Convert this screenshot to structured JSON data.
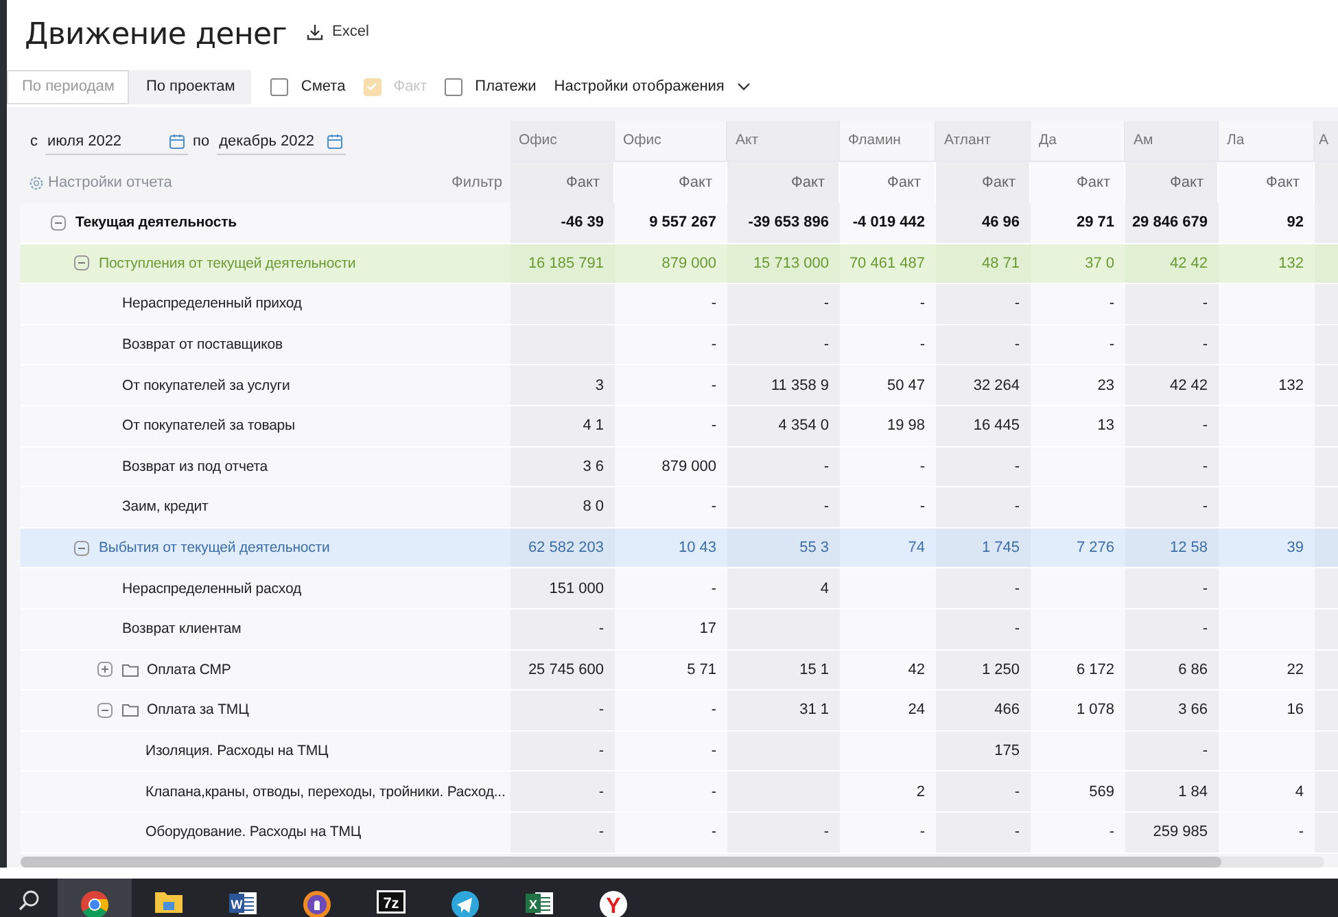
{
  "page": {
    "title": "Движение денег",
    "export_label": "Excel"
  },
  "view_tabs": [
    {
      "label": "По периодам",
      "selected": false
    },
    {
      "label": "По проектам",
      "selected": true
    }
  ],
  "toggles": [
    {
      "label": "Смета",
      "checked": false,
      "disabled": false
    },
    {
      "label": "Факт",
      "checked": true,
      "disabled": true
    },
    {
      "label": "Платежи",
      "checked": false,
      "disabled": false
    }
  ],
  "display_settings": "Настройки отображения",
  "period": {
    "from_prefix": "с",
    "from": "июля 2022",
    "to_prefix": "по",
    "to": "декабрь 2022"
  },
  "report_settings": "Настройки отчета",
  "filter": "Фильтр",
  "table": {
    "columns": [
      {
        "project": "Офис",
        "measure": "Факт"
      },
      {
        "project": "Офис",
        "measure": "Факт"
      },
      {
        "project": "Акт",
        "measure": "Факт"
      },
      {
        "project": "Фламин",
        "measure": "Факт"
      },
      {
        "project": "Атлант",
        "measure": "Факт"
      },
      {
        "project": "Да",
        "measure": "Факт"
      },
      {
        "project": "Ам",
        "measure": "Факт"
      },
      {
        "project": "Ла",
        "measure": "Факт"
      },
      {
        "project": "А"
      }
    ],
    "rows": [
      {
        "label": "Текущая деятельность",
        "kind": "total",
        "expanded": true,
        "values": {
          "column_1": "-46 39",
          "column_2": "9 557 267",
          "column_3": "-39 653 896",
          "column_4": "-4 019 442",
          "column_5": "46 96",
          "column_6": "29 71",
          "column_7": "29 846 679",
          "column_8": "92"
        },
        "children": [
          {
            "label": "Поступления от текущей деятельности",
            "kind": "income",
            "expanded": true,
            "values": {
              "column_1": "16 185 791",
              "column_2": "879 000",
              "column_3": "15 713 000",
              "column_4": "70 461 487",
              "column_5": "48 71",
              "column_6": "37 0",
              "column_7": "42 42",
              "column_8": "132"
            },
            "children": [
              {
                "label": "Нераспределенный приход",
                "kind": "item",
                "values": {
                  "column_2": "-",
                  "column_3": "-",
                  "column_4": "-",
                  "column_5": "-",
                  "column_6": "-",
                  "column_7": "-"
                }
              },
              {
                "label": "Возврат от поставщиков",
                "kind": "item",
                "values": {
                  "column_2": "-",
                  "column_3": "-",
                  "column_4": "-",
                  "column_5": "-",
                  "column_6": "-",
                  "column_7": "-"
                }
              },
              {
                "label": "От покупателей за услуги",
                "kind": "item",
                "values": {
                  "column_1": "3",
                  "column_2": "-",
                  "column_3": "11 358 9",
                  "column_4": "50 47",
                  "column_5": "32 264",
                  "column_6": "23",
                  "column_7": "42 42",
                  "column_8": "132"
                }
              },
              {
                "label": "От покупателей за товары",
                "kind": "item",
                "values": {
                  "column_1": "4 1",
                  "column_2": "-",
                  "column_3": "4 354 0",
                  "column_4": "19 98",
                  "column_5": "16 445",
                  "column_6": "13",
                  "column_7": "-"
                }
              },
              {
                "label": "Возврат из под отчета",
                "kind": "item",
                "values": {
                  "column_1": "3 6",
                  "column_2": "879 000",
                  "column_3": "-",
                  "column_4": "-",
                  "column_5": "-",
                  "column_7": "-"
                }
              },
              {
                "label": "Заим, кредит",
                "kind": "item",
                "values": {
                  "column_1": "8 0",
                  "column_2": "-",
                  "column_3": "-",
                  "column_4": "-",
                  "column_5": "-",
                  "column_7": "-"
                }
              }
            ]
          },
          {
            "label": "Выбытия от текущей деятельности",
            "kind": "expense",
            "expanded": true,
            "values": {
              "column_1": "62 582 203",
              "column_2": "10 43",
              "column_3": "55 3",
              "column_4": "74",
              "column_5": "1 745",
              "column_6": "7 276",
              "column_7": "12 58",
              "column_8": "39"
            },
            "children": [
              {
                "label": "Нераспределенный расход",
                "kind": "item",
                "values": {
                  "column_1": "151 000",
                  "column_2": "-",
                  "column_3": "4",
                  "column_5": "-",
                  "column_7": "-"
                }
              },
              {
                "label": "Возврат клиентам",
                "kind": "item",
                "values": {
                  "column_1": "-",
                  "column_2": "17",
                  "column_5": "-",
                  "column_7": "-"
                }
              },
              {
                "label": "Оплата СМР",
                "kind": "folder",
                "expanded": false,
                "values": {
                  "column_1": "25 745 600",
                  "column_2": "5 71",
                  "column_3": "15 1",
                  "column_4": "42",
                  "column_5": "1 250",
                  "column_6": "6 172",
                  "column_7": "6 86",
                  "column_8": "22"
                }
              },
              {
                "label": "Оплата за ТМЦ",
                "kind": "folder",
                "expanded": true,
                "values": {
                  "column_1": "-",
                  "column_2": "-",
                  "column_3": "31 1",
                  "column_4": "24",
                  "column_5": "466",
                  "column_6": "1 078",
                  "column_7": "3 66",
                  "column_8": "16"
                },
                "children": [
                  {
                    "label": "Изоляция. Расходы на ТМЦ",
                    "kind": "item",
                    "values": {
                      "column_1": "-",
                      "column_2": "-",
                      "column_5": "175",
                      "column_7": "-"
                    }
                  },
                  {
                    "label": "Клапана,краны, отводы, переходы, тройники. Расход...",
                    "kind": "item",
                    "values": {
                      "column_1": "-",
                      "column_2": "-",
                      "column_4": "2",
                      "column_5": "-",
                      "column_6": "569",
                      "column_7": "1 84",
                      "column_8": "4"
                    }
                  },
                  {
                    "label": "Оборудование. Расходы на ТМЦ",
                    "kind": "item",
                    "values": {
                      "column_1": "-",
                      "column_2": "-",
                      "column_3": "-",
                      "column_4": "-",
                      "column_5": "-",
                      "column_6": "-",
                      "column_7": "259 985",
                      "column_8": "-"
                    }
                  }
                ]
              }
            ]
          }
        ]
      }
    ]
  },
  "taskbar": {
    "items": [
      {
        "kind": "search",
        "selected": false
      },
      {
        "kind": "chrome",
        "selected": true
      },
      {
        "kind": "folder",
        "selected": false
      },
      {
        "kind": "word",
        "label": "W",
        "selected": false
      },
      {
        "kind": "shield",
        "selected": false
      },
      {
        "kind": "archive",
        "label": "7z",
        "selected": false
      },
      {
        "kind": "telegram",
        "selected": false
      },
      {
        "kind": "excel",
        "label": "X",
        "selected": false
      },
      {
        "kind": "yandex",
        "label": "Y",
        "selected": false
      }
    ]
  }
}
